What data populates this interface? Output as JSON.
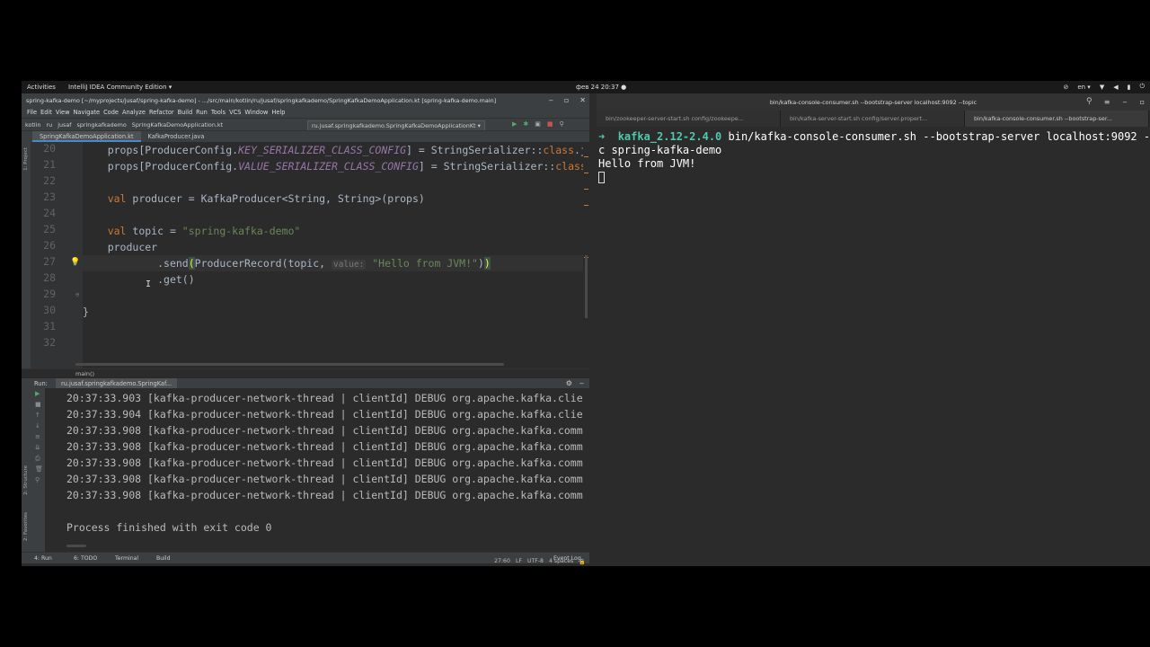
{
  "topbar": {
    "activities": "Activities",
    "app_menu": "IntelliJ IDEA Community Edition ▾",
    "clock": "фев 24  20:37 ●",
    "lang": "en ▾"
  },
  "ide": {
    "title": "spring-kafka-demo [~/myprojects/jusaf/spring-kafka-demo] - .../src/main/kotlin/ru/jusaf/springkafkademo/SpringKafkaDemoApplication.kt [spring-kafka-demo.main]",
    "menu": [
      "File",
      "Edit",
      "View",
      "Navigate",
      "Code",
      "Analyze",
      "Refactor",
      "Build",
      "Run",
      "Tools",
      "VCS",
      "Window",
      "Help"
    ],
    "nav": [
      "kotlin",
      "ru",
      "jusaf",
      "springkafkademo",
      "SpringKafkaDemoApplication.kt"
    ],
    "run_config": "ru.jusaf.springkafkademo.SpringKafkaDemoApplicationKt ▾",
    "tabs": [
      "SpringKafkaDemoApplication.kt",
      "KafkaProducer.java"
    ],
    "left_strip": [
      "1: Project",
      "2: Structure",
      "2: Favorites"
    ],
    "line_numbers": [
      "20",
      "21",
      "22",
      "23",
      "24",
      "25",
      "26",
      "27",
      "28",
      "29",
      "30",
      "31",
      "32"
    ],
    "code": {
      "l20_a": "props[ProducerConfig.",
      "l20_b": "KEY_SERIALIZER_CLASS_CONFIG",
      "l20_c": "] = StringSerializer::",
      "l20_d": "class",
      "l20_e": ".j",
      "l21_a": "props[ProducerConfig.",
      "l21_b": "VALUE_SERIALIZER_CLASS_CONFIG",
      "l21_c": "] = StringSerializer::",
      "l21_d": "class",
      "l23_kw": "val",
      "l23_rest": " producer = KafkaProducer<String, String>(props)",
      "l25_kw": "val",
      "l25_mid": " topic = ",
      "l25_str": "\"spring-kafka-demo\"",
      "l26": "producer",
      "l27_a": "        .send",
      "l27_b": "(",
      "l27_c": "ProducerRecord(topic, ",
      "l27_hint": "value:",
      "l27_str": "\"Hello from JVM!\"",
      "l27_d": ")",
      "l27_e": ")",
      "l28": "        .get()",
      "l30": "}"
    },
    "breadcrumb": "main()",
    "run": {
      "label": "Run:",
      "tab": "ru.jusaf.springkafkademo.SpringKaf...",
      "logs": [
        "20:37:33.903 [kafka-producer-network-thread | clientId] DEBUG org.apache.kafka.clie",
        "20:37:33.904 [kafka-producer-network-thread | clientId] DEBUG org.apache.kafka.clie",
        "20:37:33.908 [kafka-producer-network-thread | clientId] DEBUG org.apache.kafka.comm",
        "20:37:33.908 [kafka-producer-network-thread | clientId] DEBUG org.apache.kafka.comm",
        "20:37:33.908 [kafka-producer-network-thread | clientId] DEBUG org.apache.kafka.comm",
        "20:37:33.908 [kafka-producer-network-thread | clientId] DEBUG org.apache.kafka.comm",
        "20:37:33.908 [kafka-producer-network-thread | clientId] DEBUG org.apache.kafka.comm"
      ],
      "exit": "Process finished with exit code 0"
    },
    "bottom_tabs": [
      "4: Run",
      "6: TODO",
      "Terminal",
      "Build"
    ],
    "event_log": "Event Log",
    "status": {
      "pos": "27:60",
      "lf": "LF",
      "enc": "UTF-8",
      "indent": "4 spaces"
    }
  },
  "terminal": {
    "title": "bin/kafka-console-consumer.sh --bootstrap-server localhost:9092 --topic",
    "tabs": [
      "bin/zookeeper-server-start.sh config/zookeepe...",
      "bin/kafka-server-start.sh config/server.propert...",
      "bin/kafka-console-consumer.sh --bootstrap-ser..."
    ],
    "prompt_arrow": "➜",
    "prompt_dir": "kafka_2.12-2.4.0",
    "command": " bin/kafka-console-consumer.sh --bootstrap-server localhost:9092 --to",
    "command_wrap": "c spring-kafka-demo",
    "output": "Hello from JVM!"
  }
}
